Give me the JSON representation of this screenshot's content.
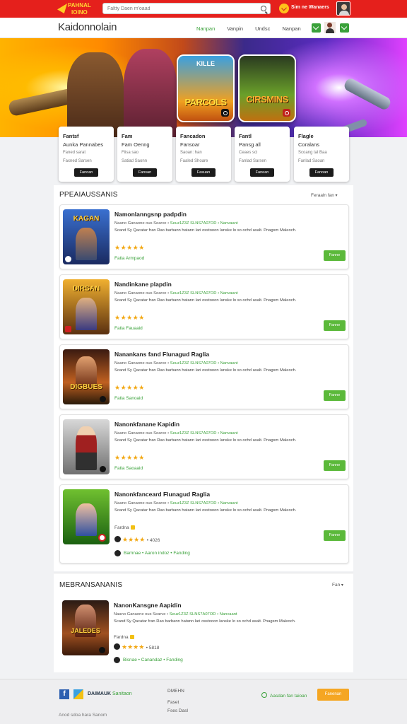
{
  "header": {
    "logo_text": "PAHNAL\nIOINO",
    "search_placeholder": "Faltty Daen m'oaad",
    "signin_label": "Sim ne Wanaers"
  },
  "nav": {
    "brand": "Kaidonnolain",
    "links": [
      "Nanpan",
      "Vanpin",
      "Undsc",
      "Nanpan"
    ]
  },
  "hero": {
    "tiles": [
      {
        "top": "KILLE",
        "title": "PARCOLS"
      },
      {
        "title": "CIRSMINS"
      }
    ]
  },
  "promos": [
    {
      "title": "Fantsf",
      "sub": "Aunka Pannabes",
      "l1": "Faned sarat",
      "l2": "Faxned Sarsen",
      "btn": "Fanoan"
    },
    {
      "title": "Fam",
      "sub": "Fam Oenng",
      "l1": "Fiisa sao",
      "l2": "Satiad Saonn",
      "btn": "Fansan"
    },
    {
      "title": "Fancadon",
      "sub": "Fansoar",
      "l1": "Saoan: han",
      "l2": "Faaled Shoare",
      "btn": "Fasuan"
    },
    {
      "title": "Fantl",
      "sub": "Pansg all",
      "l1": "Ceaes sci",
      "l2": "Fanlad Sarsen",
      "btn": "Fanean"
    },
    {
      "title": "Flagle",
      "sub": "Coralans",
      "l1": "Scoang tal Baa",
      "l2": "Fanlad Saoan",
      "btn": "Fanoan"
    }
  ],
  "section1": {
    "title": "PPEAIAUSSANIS",
    "link": "Feraaln fan"
  },
  "games": [
    {
      "title": "Namonlanngsnp padpdin",
      "meta": "Naano Ganaone ous Searve •",
      "meta_g": "Seuz1Z3Z SLNS7A07OD • Nanvaant",
      "desc": "Scand Sy Qacatar fran Rao barbann hatann lari osstooon lanske lo so ochd asalt. Pnagsm Maleoch.",
      "stars": "★★★★★",
      "link": "Fatia Armpaod",
      "install": "Fanne",
      "thumb_title": "KAGAN"
    },
    {
      "title": "Nandinkane plapdin",
      "meta": "Naano Ganaone ous Searve •",
      "meta_g": "Seuz1Z3Z SLNS7A07OD • Nanvaant",
      "desc": "Scand Sy Qacatar fran Rao barbann hatann lari osstooon lanske lo so ochd asalt. Pnagsm Maleoch.",
      "stars": "★★★★★",
      "link": "Fatia Fauaaid",
      "install": "Fanne",
      "thumb_title": "DIRSAN"
    },
    {
      "title": "Nanankans fand Flunagud Raglia",
      "meta": "Naano Ganaone ous Searve •",
      "meta_g": "Seuz1Z3Z SLNS7A07OD • Nanvaant",
      "desc": "Scand Sy Qacatar fran Rao barbann hatann lari osstooon lanske lo so ochd asalt. Pnagsm Maleoch.",
      "stars": "★★★★★",
      "link": "Fatia Sanoaid",
      "install": "Fanne",
      "thumb_title": "DIGBUES"
    },
    {
      "title": "Nanonkfanane Kapidin",
      "meta": "Naano Ganaone ous Searve •",
      "meta_g": "Seuz1Z3Z SLNS7A07OD • Nanvaant",
      "desc": "Scand Sy Qacatar fran Rao barbann hatann lari osstooon lanske lo so ochd asalt. Pnagsm Maleoch.",
      "stars": "★★★★★",
      "link": "Fatia Saoaaid",
      "install": "Fanne",
      "thumb_title": ""
    },
    {
      "title": "Nanonkfanceard Flunagud Raglia",
      "meta": "Naano Ganaone ous Searve •",
      "meta_g": "Seuz1Z3Z SLNS7A07OD • Nanvaant",
      "desc": "Scand Sy Qacatar fran Rao barbann hatann lari osstooon lanske lo so ochd asalt. Pnagsm Maleoch.",
      "badge": "Fardna",
      "stars": "★★★★",
      "rating": "4026",
      "reviews": "Bamnae • Aaron indoz • Fanding",
      "install": "Fanne",
      "thumb_title": ""
    }
  ],
  "section2": {
    "title": "MEBRANSANANIS",
    "link": "Fan"
  },
  "games2": [
    {
      "title": "NanonKansgne Aapidin",
      "meta": "Naano Ganaone ous Searve •",
      "meta_g": "Seuz1Z3Z SLNS7A07OD • Nanvaant",
      "desc": "Scand Sy Qacatar fran Rao barbann hatann lari osstooon lanske lo so ochd asalt. Pnagsm Maleoch.",
      "badge": "Fardna",
      "stars": "★★★★",
      "rating": "5818",
      "reviews": "Bisnae • Canandaz • Fanding",
      "thumb_title": "JALEDES"
    }
  ],
  "footer": {
    "brand": "DAIMAUK",
    "brand_g": "Sanitaon",
    "col": [
      "DMEHN",
      "Faset",
      "Fses Dasl"
    ],
    "status": "Aasdan fan taioan",
    "cta": "Fanenan",
    "copy": "Anod sdoa hara Sanom"
  },
  "colors": {
    "top_bar": "#e5201c",
    "accent_green": "#3aa13a",
    "install_green": "#5bb93a",
    "star_gold": "#f2a814",
    "cta_orange": "#f5a623"
  }
}
